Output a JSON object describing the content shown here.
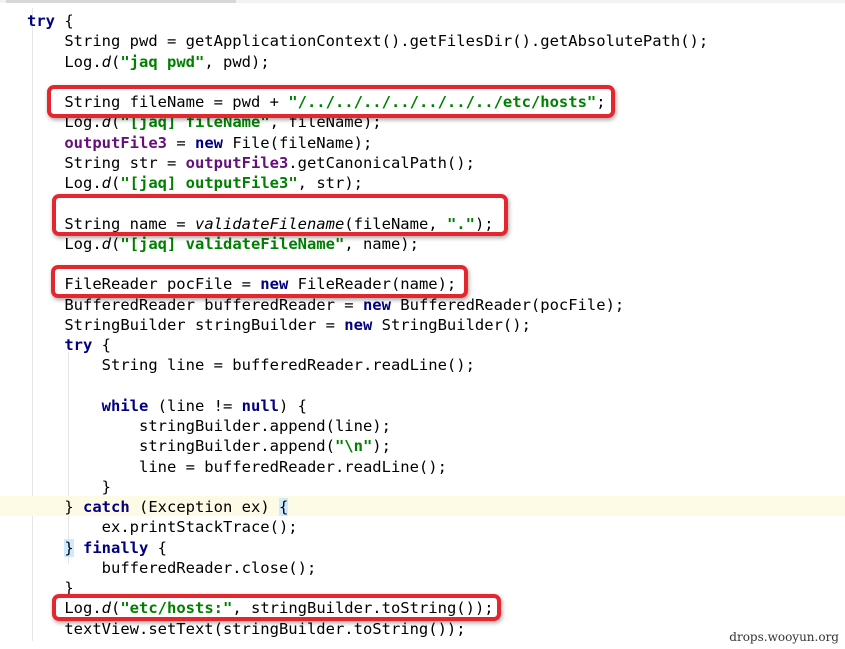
{
  "code_lines": [
    [
      {
        "t": "try",
        "c": "kw"
      },
      {
        "t": " {"
      }
    ],
    [
      {
        "t": "    String pwd = getApplicationContext().getFilesDir().getAbsolutePath();"
      }
    ],
    [
      {
        "t": "    Log."
      },
      {
        "t": "d",
        "c": "it"
      },
      {
        "t": "("
      },
      {
        "t": "\"jaq pwd\"",
        "c": "str"
      },
      {
        "t": ", pwd);"
      }
    ],
    [],
    [
      {
        "t": "    String fileName = pwd + "
      },
      {
        "t": "\"/../../../../../../../etc/hosts\"",
        "c": "str"
      },
      {
        "t": ";"
      }
    ],
    [
      {
        "t": "    Log."
      },
      {
        "t": "d",
        "c": "it"
      },
      {
        "t": "("
      },
      {
        "t": "\"[jaq] fileName\"",
        "c": "str"
      },
      {
        "t": ", fileName);"
      }
    ],
    [
      {
        "t": "    "
      },
      {
        "t": "outputFile3",
        "c": "fld"
      },
      {
        "t": " = "
      },
      {
        "t": "new",
        "c": "kw"
      },
      {
        "t": " File(fileName);"
      }
    ],
    [
      {
        "t": "    String str = "
      },
      {
        "t": "outputFile3",
        "c": "fld"
      },
      {
        "t": ".getCanonicalPath();"
      }
    ],
    [
      {
        "t": "    Log."
      },
      {
        "t": "d",
        "c": "it"
      },
      {
        "t": "("
      },
      {
        "t": "\"[jaq] outputFile3\"",
        "c": "str"
      },
      {
        "t": ", str);"
      }
    ],
    [],
    [
      {
        "t": "    String name = "
      },
      {
        "t": "validateFilename",
        "c": "it"
      },
      {
        "t": "(fileName, "
      },
      {
        "t": "\".\"",
        "c": "str"
      },
      {
        "t": ");"
      }
    ],
    [
      {
        "t": "    Log."
      },
      {
        "t": "d",
        "c": "it"
      },
      {
        "t": "("
      },
      {
        "t": "\"[jaq] validateFileName\"",
        "c": "str"
      },
      {
        "t": ", name);"
      }
    ],
    [],
    [
      {
        "t": "    FileReader pocFile = "
      },
      {
        "t": "new",
        "c": "kw"
      },
      {
        "t": " FileReader(name);"
      }
    ],
    [
      {
        "t": "    BufferedReader bufferedReader = "
      },
      {
        "t": "new",
        "c": "kw"
      },
      {
        "t": " BufferedReader(pocFile);"
      }
    ],
    [
      {
        "t": "    StringBuilder stringBuilder = "
      },
      {
        "t": "new",
        "c": "kw"
      },
      {
        "t": " StringBuilder();"
      }
    ],
    [
      {
        "t": "    "
      },
      {
        "t": "try",
        "c": "kw"
      },
      {
        "t": " {"
      }
    ],
    [
      {
        "t": "        String line = bufferedReader.readLine();"
      }
    ],
    [],
    [
      {
        "t": "        "
      },
      {
        "t": "while",
        "c": "kw"
      },
      {
        "t": " (line != "
      },
      {
        "t": "null",
        "c": "kw"
      },
      {
        "t": ") {"
      }
    ],
    [
      {
        "t": "            stringBuilder.append(line);"
      }
    ],
    [
      {
        "t": "            stringBuilder.append("
      },
      {
        "t": "\"\\n\"",
        "c": "str"
      },
      {
        "t": ");"
      }
    ],
    [
      {
        "t": "            line = bufferedReader.readLine();"
      }
    ],
    [
      {
        "t": "        }"
      }
    ],
    [
      {
        "t": "    } "
      },
      {
        "t": "catch",
        "c": "kw"
      },
      {
        "t": " (Exception ex) "
      },
      {
        "t": "{",
        "c": "brm"
      }
    ],
    [
      {
        "t": "        ex.printStackTrace();"
      }
    ],
    [
      {
        "t": "    "
      },
      {
        "t": "}",
        "c": "brm"
      },
      {
        "t": " "
      },
      {
        "t": "finally",
        "c": "kw"
      },
      {
        "t": " {"
      }
    ],
    [
      {
        "t": "        bufferedReader.close();"
      }
    ],
    [
      {
        "t": "    }"
      }
    ],
    [
      {
        "t": "    Log."
      },
      {
        "t": "d",
        "c": "it"
      },
      {
        "t": "("
      },
      {
        "t": "\"etc/hosts:\"",
        "c": "str"
      },
      {
        "t": ", stringBuilder.toString());"
      }
    ],
    [
      {
        "t": "    textView.setText(stringBuilder.toString());"
      }
    ]
  ],
  "watermark": "drops.wooyun.org",
  "colors": {
    "keyword": "#000080",
    "string": "#008000",
    "field": "#660e7a",
    "callout": "#e4262f",
    "current_line": "#fdfbe6",
    "brace_match": "#cdeaff"
  }
}
